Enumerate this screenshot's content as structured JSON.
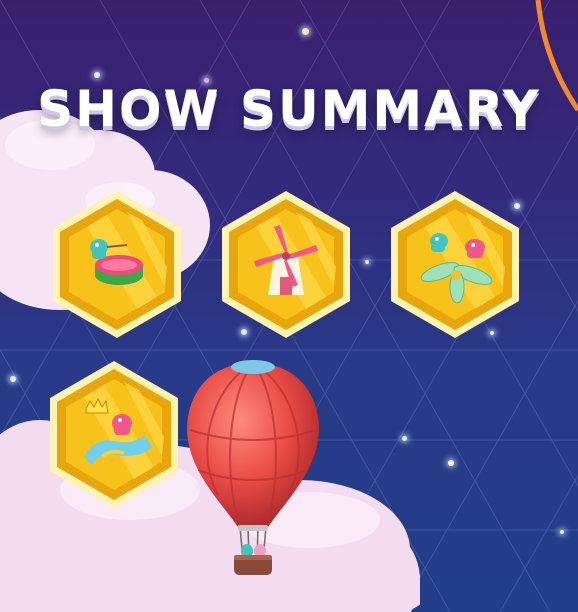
{
  "title": "SHOW SUMMARY",
  "colors": {
    "sky_top": "#3a1f6e",
    "sky_bottom": "#223e88",
    "badge_gold": "#f7c21a",
    "badge_rim": "#fff3b0",
    "balloon_red": "#e84a44"
  },
  "badges": [
    {
      "icon": "fall-guy-drum-icon"
    },
    {
      "icon": "windmill-icon"
    },
    {
      "icon": "fall-guys-fan-icon"
    },
    {
      "icon": "fall-guy-crown-slide-icon"
    }
  ],
  "decorations": [
    "hot-air-balloon",
    "cloud",
    "stars"
  ]
}
